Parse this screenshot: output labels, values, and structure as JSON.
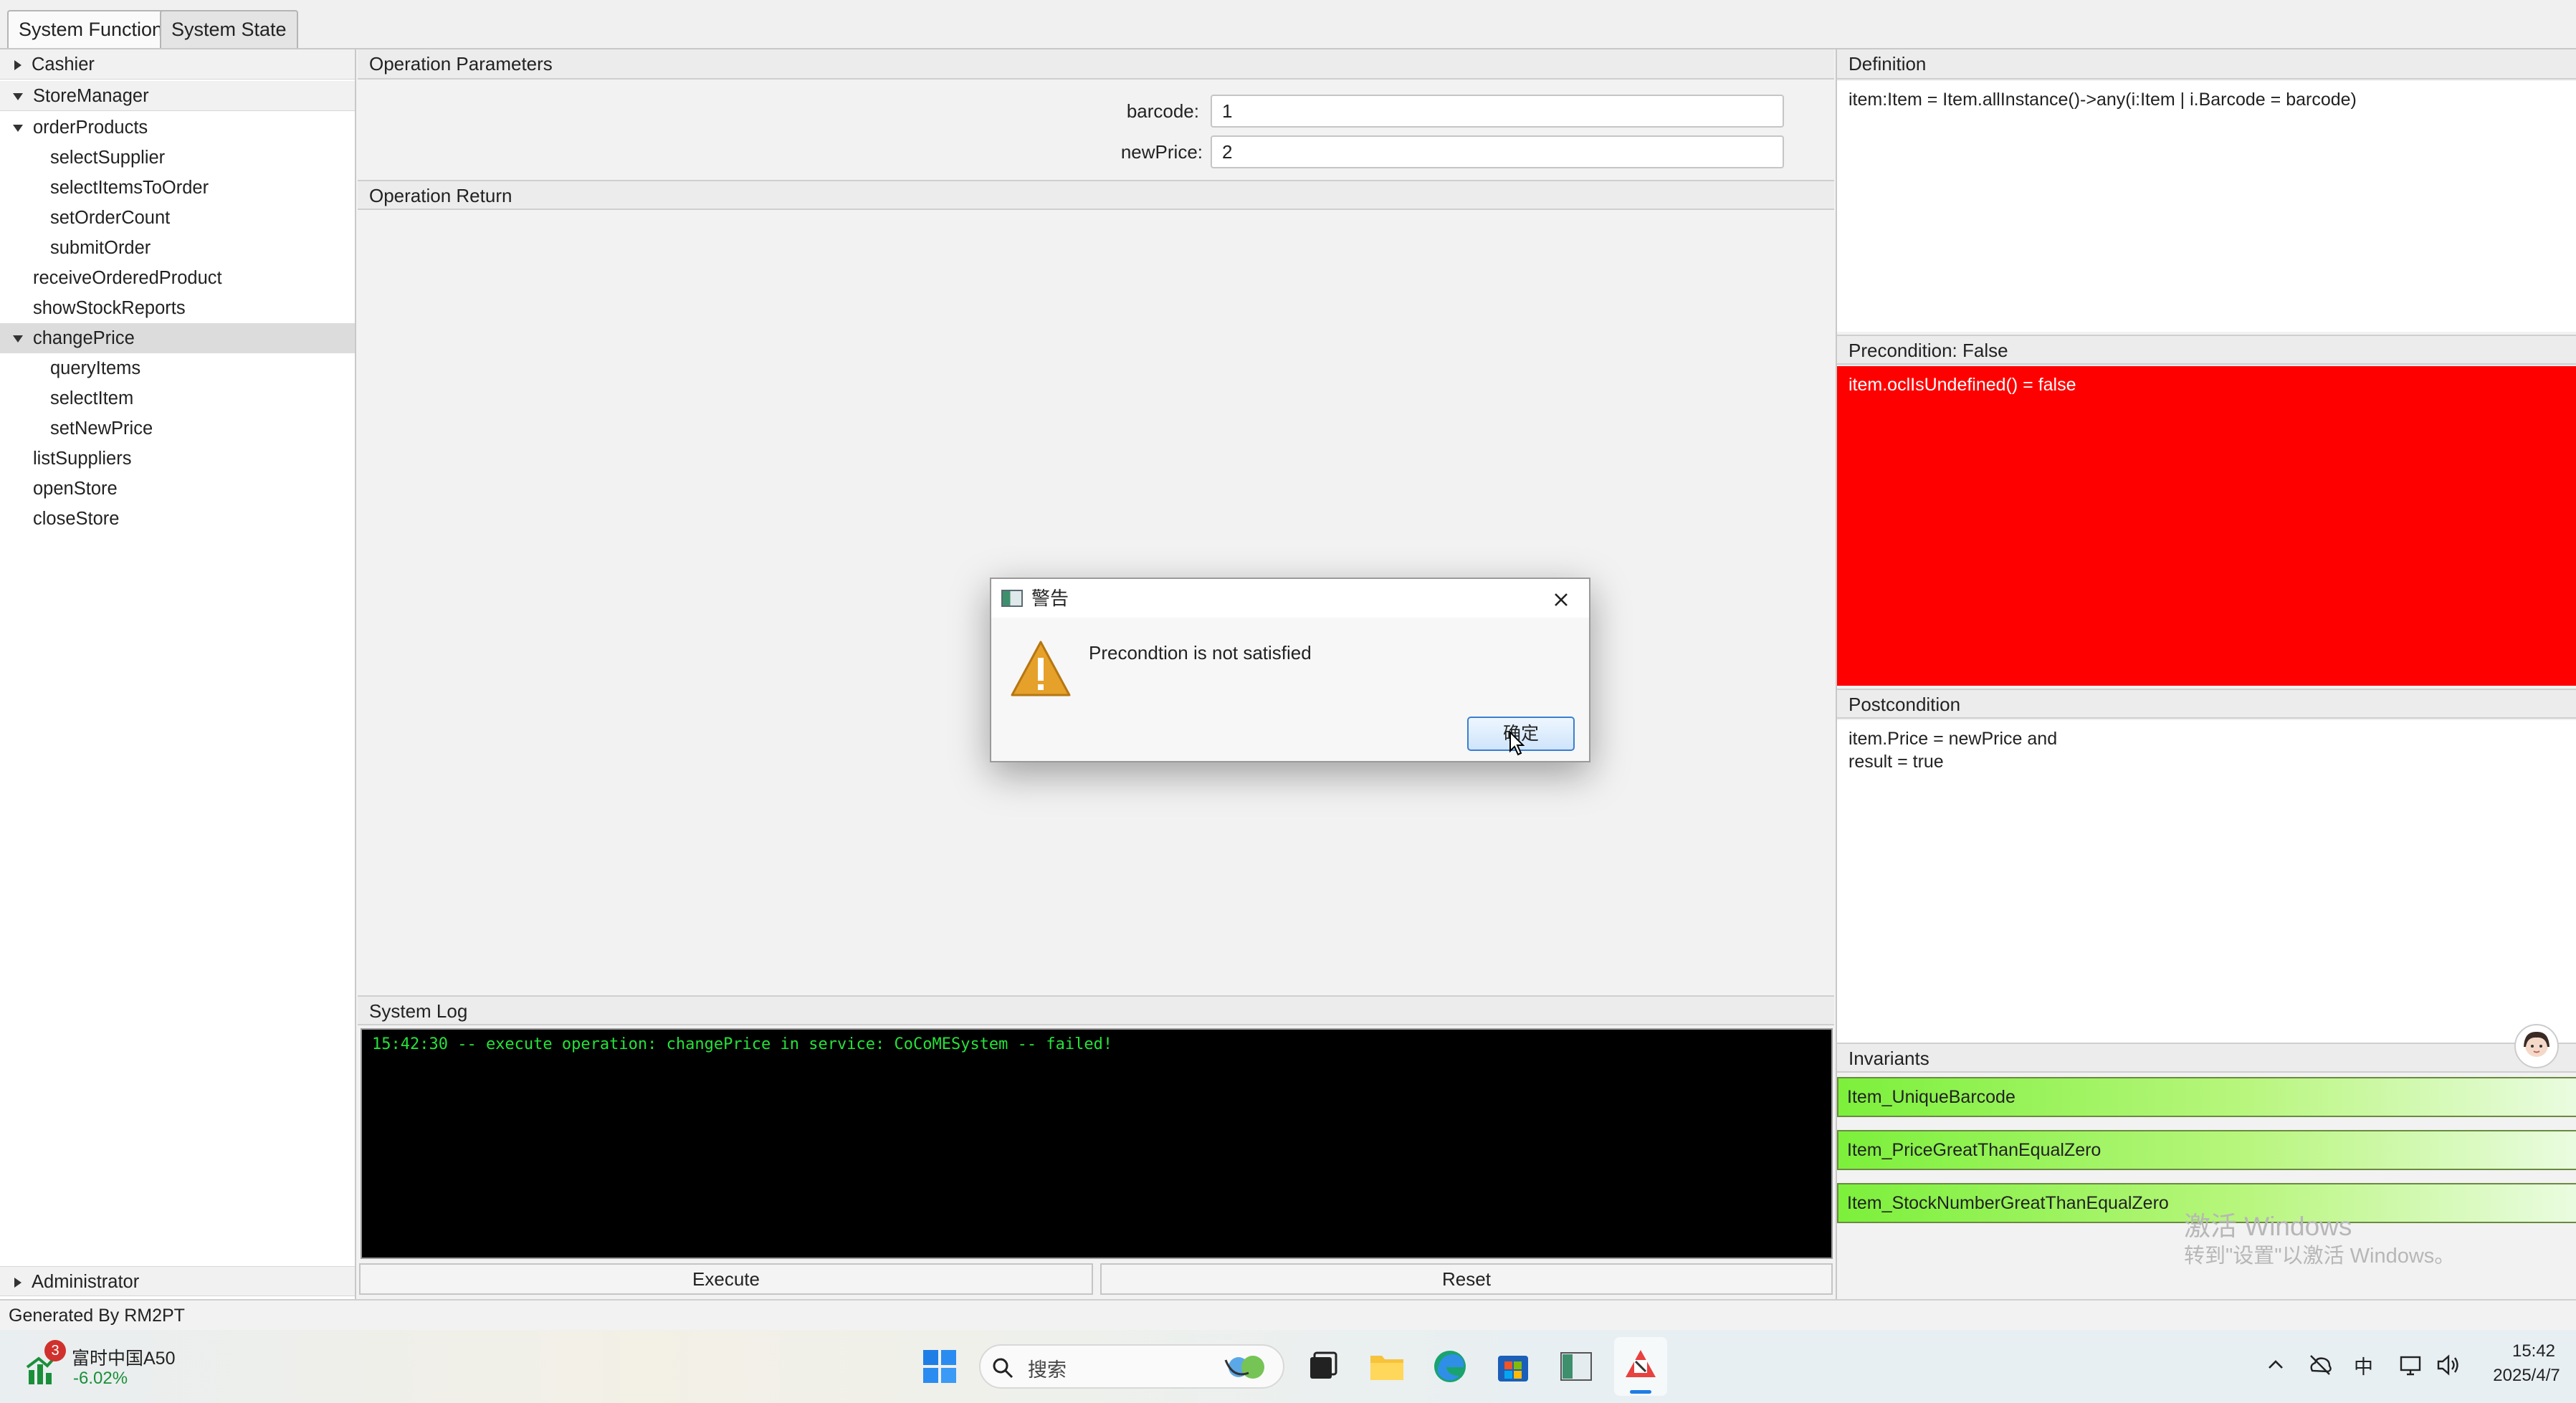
{
  "tabs": [
    "System Function",
    "System State"
  ],
  "tree": {
    "cashier": "Cashier",
    "store_manager": "StoreManager",
    "order_products": "orderProducts",
    "order_children": [
      "selectSupplier",
      "selectItemsToOrder",
      "setOrderCount",
      "submitOrder"
    ],
    "receive": "receiveOrderedProduct",
    "show_stock": "showStockReports",
    "change_price": "changePrice",
    "change_children": [
      "queryItems",
      "selectItem",
      "setNewPrice"
    ],
    "list_suppliers": "listSuppliers",
    "open_store": "openStore",
    "close_store": "closeStore",
    "administrator": "Administrator"
  },
  "params": {
    "title": "Operation Parameters",
    "barcode_label": "barcode:",
    "barcode_value": "1",
    "newprice_label": "newPrice:",
    "newprice_value": "2"
  },
  "operation_return": {
    "title": "Operation Return"
  },
  "system_log": {
    "title": "System Log",
    "line": "15:42:30 -- execute operation: changePrice in service: CoCoMESystem  -- failed!"
  },
  "buttons": {
    "execute": "Execute",
    "reset": "Reset"
  },
  "definition": {
    "title": "Definition",
    "text": "item:Item = Item.allInstance()->any(i:Item | i.Barcode = barcode)"
  },
  "precondition": {
    "title": "Precondition: False",
    "text": "item.oclIsUndefined() = false",
    "color": "#ff0000"
  },
  "postcondition": {
    "title": "Postcondition",
    "line1": "item.Price = newPrice and",
    "line2": "result = true"
  },
  "invariants": {
    "title": "Invariants",
    "items": [
      "Item_UniqueBarcode",
      "Item_PriceGreatThanEqualZero",
      "Item_StockNumberGreatThanEqualZero"
    ]
  },
  "status_bar": "Generated By RM2PT",
  "dialog": {
    "title": "警告",
    "message": "Precondtion is not satisfied",
    "ok": "确定"
  },
  "watermark": {
    "line1": "激活 Windows",
    "line2": "转到\"设置\"以激活 Windows。"
  },
  "taskbar": {
    "stock_badge": "3",
    "stock_name": "富时中国A50",
    "stock_change": "-6.02%",
    "search_placeholder": "搜索",
    "ime": "中",
    "time": "15:42",
    "date": "2025/4/7"
  }
}
